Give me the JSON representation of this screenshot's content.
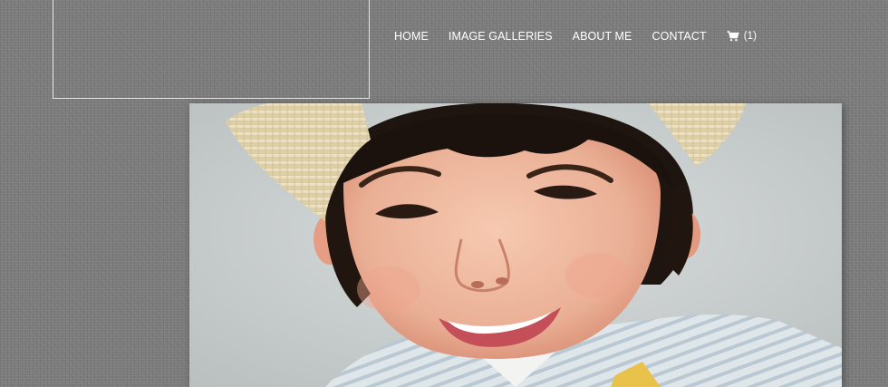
{
  "nav": {
    "items": [
      {
        "label": "HOME"
      },
      {
        "label": "IMAGE GALLERIES"
      },
      {
        "label": "ABOUT ME"
      },
      {
        "label": "CONTACT"
      }
    ],
    "cart": {
      "icon": "shopping-cart-icon",
      "count": "(1)"
    }
  },
  "colors": {
    "background": "#7b7b7b",
    "nav_text": "#ffffff",
    "logo_border": "#e6e6e6"
  }
}
